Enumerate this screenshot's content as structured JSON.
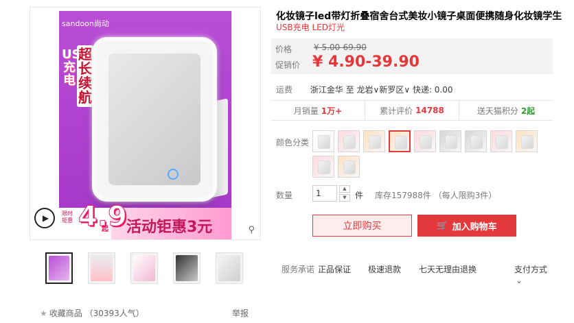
{
  "product": {
    "title": "化妆镜子led带灯折叠宿舍台式美妆小镜子桌面便携随身化妆镜学生",
    "subtitle": "USB充电 LED灯光"
  },
  "gallery": {
    "brand": "sandoon尚动",
    "usb_text": "USB充电",
    "promo_text": "超长续航",
    "limit_text": "限时钜惠",
    "price_big": "4.9",
    "price_small": "起",
    "event_text": "活动钜惠3元",
    "play_icon": "play-icon",
    "zoom_icon": "zoom-icon"
  },
  "price": {
    "orig_label": "价格",
    "orig_value": "¥ 5.00-69.90",
    "promo_label": "促销价",
    "promo_value": "¥ 4.90-39.90"
  },
  "shipping": {
    "label": "运费",
    "from": "浙江金华",
    "to_word": "至",
    "dest": "龙岩∨新罗区∨",
    "method": "快递: 0.00"
  },
  "stats": {
    "monthly_label": "月销量",
    "monthly_value": "1万+",
    "reviews_label": "累计评价",
    "reviews_value": "14788",
    "points_label": "送天猫积分",
    "points_value": "2起"
  },
  "color": {
    "label": "颜色分类",
    "swatch_count": 10,
    "selected_index": 3
  },
  "quantity": {
    "label": "数量",
    "value": "1",
    "unit": "件",
    "stock": "库存157988件 （每人限购3件）"
  },
  "buttons": {
    "buy": "立即购买",
    "cart": "加入购物车"
  },
  "service": {
    "label": "服务承诺",
    "items": [
      "正品保证",
      "极速退款",
      "七天无理由退换"
    ],
    "pay": "支付方式"
  },
  "footer": {
    "fav": "收藏商品",
    "popularity": "（30393人气）",
    "report": "举报"
  },
  "colors": {
    "accent": "#e4393c",
    "price_bg": "#f2f2f2",
    "points_green": "#339933"
  }
}
